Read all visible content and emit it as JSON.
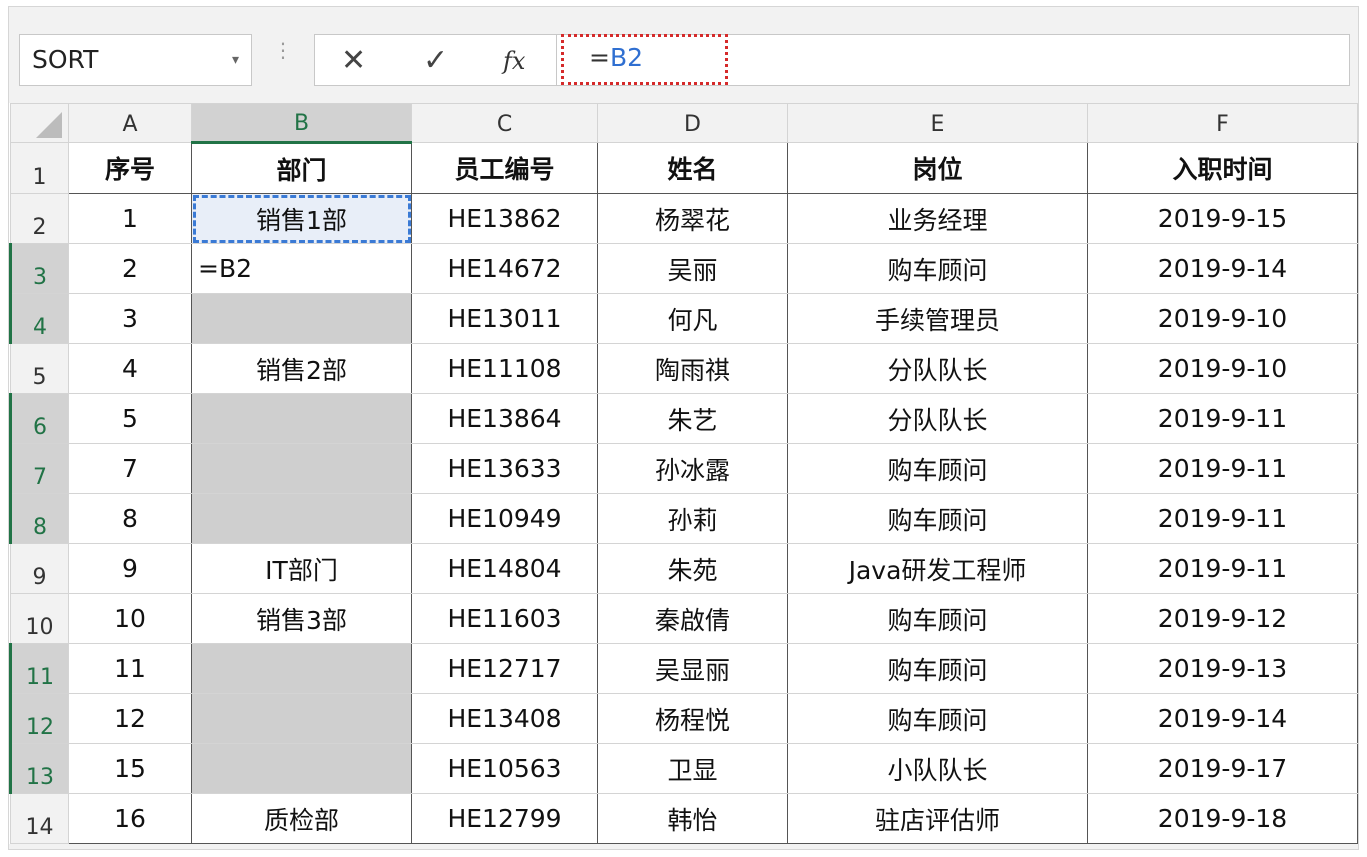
{
  "name_box": "SORT",
  "name_box_arrow": "▾",
  "formula_bar": {
    "cancel_icon": "✕",
    "enter_icon": "✓",
    "fx_label": "fx",
    "formula_eq": "=",
    "formula_ref": "B2"
  },
  "columns": [
    "A",
    "B",
    "C",
    "D",
    "E",
    "F"
  ],
  "rows": [
    {
      "row": "1",
      "cells": [
        "序号",
        "部门",
        "员工编号",
        "姓名",
        "岗位",
        "入职时间"
      ]
    },
    {
      "row": "2",
      "cells": [
        "1",
        "销售1部",
        "HE13862",
        "杨翠花",
        "业务经理",
        "2019-9-15"
      ]
    },
    {
      "row": "3",
      "cells": [
        "2",
        "=B2",
        "HE14672",
        "吴丽",
        "购车顾问",
        "2019-9-14"
      ]
    },
    {
      "row": "4",
      "cells": [
        "3",
        "",
        "HE13011",
        "何凡",
        "手续管理员",
        "2019-9-10"
      ]
    },
    {
      "row": "5",
      "cells": [
        "4",
        "销售2部",
        "HE11108",
        "陶雨祺",
        "分队队长",
        "2019-9-10"
      ]
    },
    {
      "row": "6",
      "cells": [
        "5",
        "",
        "HE13864",
        "朱艺",
        "分队队长",
        "2019-9-11"
      ]
    },
    {
      "row": "7",
      "cells": [
        "7",
        "",
        "HE13633",
        "孙冰露",
        "购车顾问",
        "2019-9-11"
      ]
    },
    {
      "row": "8",
      "cells": [
        "8",
        "",
        "HE10949",
        "孙莉",
        "购车顾问",
        "2019-9-11"
      ]
    },
    {
      "row": "9",
      "cells": [
        "9",
        "IT部门",
        "HE14804",
        "朱苑",
        "Java研发工程师",
        "2019-9-11"
      ]
    },
    {
      "row": "10",
      "cells": [
        "10",
        "销售3部",
        "HE11603",
        "秦啟倩",
        "购车顾问",
        "2019-9-12"
      ]
    },
    {
      "row": "11",
      "cells": [
        "11",
        "",
        "HE12717",
        "吴显丽",
        "购车顾问",
        "2019-9-13"
      ]
    },
    {
      "row": "12",
      "cells": [
        "12",
        "",
        "HE13408",
        "杨程悦",
        "购车顾问",
        "2019-9-14"
      ]
    },
    {
      "row": "13",
      "cells": [
        "15",
        "",
        "HE10563",
        "卫显",
        "小队队长",
        "2019-9-17"
      ]
    },
    {
      "row": "14",
      "cells": [
        "16",
        "质检部",
        "HE12799",
        "韩怡",
        "驻店评估师",
        "2019-9-18"
      ]
    }
  ],
  "colors": {
    "accent_green": "#217346",
    "formula_ref_blue": "#2f6fd1",
    "highlight_red": "#d52a2a",
    "blank_fill": "#cfcfcf"
  }
}
